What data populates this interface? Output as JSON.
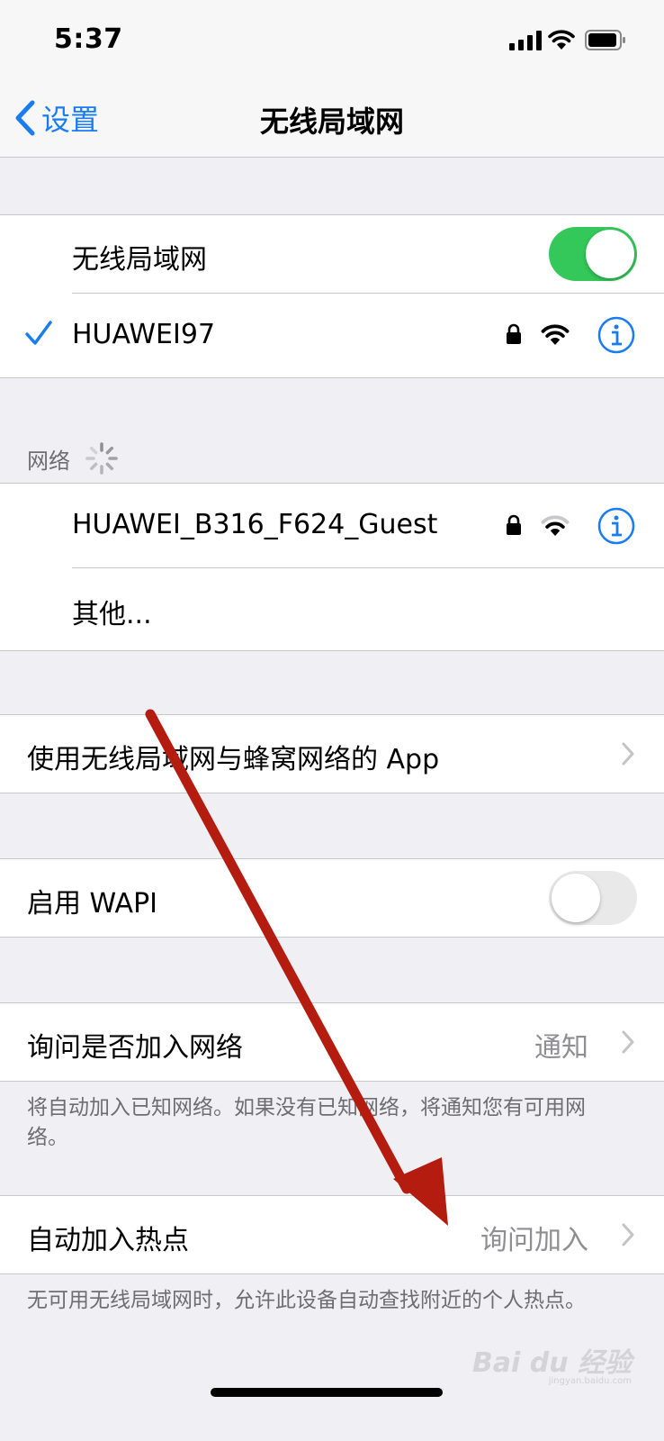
{
  "status_bar": {
    "time": "5:37",
    "icons": [
      "signal-icon",
      "wifi-icon",
      "battery-icon"
    ]
  },
  "nav": {
    "back_label": "设置",
    "title": "无线局域网"
  },
  "wlan": {
    "toggle_label": "无线局域网",
    "toggle_on": true
  },
  "connected_network": {
    "name": "HUAWEI97",
    "checked": true,
    "secured": true
  },
  "networks_header": "网络",
  "networks": [
    {
      "name": "HUAWEI_B316_F624_Guest",
      "secured": true
    },
    {
      "name": "其他..."
    }
  ],
  "apps_row": {
    "label": "使用无线局域网与蜂窝网络的 App"
  },
  "wapi": {
    "label": "启用 WAPI",
    "toggle_on": false
  },
  "ask_join": {
    "label": "询问是否加入网络",
    "value": "通知",
    "footer": "将自动加入已知网络。如果没有已知网络，将通知您有可用网络。"
  },
  "auto_hotspot": {
    "label": "自动加入热点",
    "value": "询问加入",
    "footer": "无可用无线局域网时，允许此设备自动查找附近的个人热点。"
  },
  "watermark": {
    "main": "Bai du 经验",
    "sub": "jingyan.baidu.com"
  },
  "colors": {
    "accent": "#1a7cf3",
    "toggle_on": "#34c759",
    "annotation_arrow": "#b31c0f"
  }
}
